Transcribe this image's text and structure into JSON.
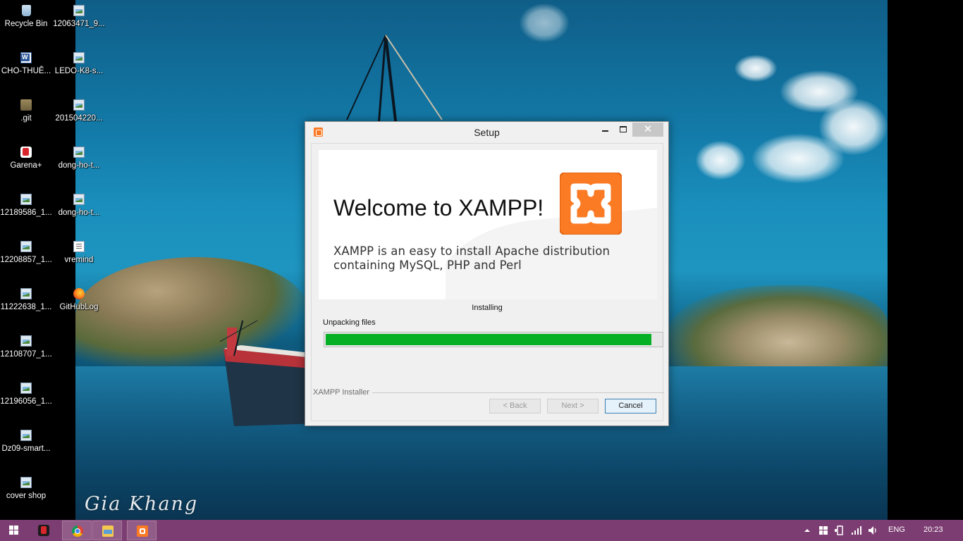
{
  "desktop": {
    "icons": [
      {
        "label": "Recycle Bin",
        "icon": "recycle-bin-icon"
      },
      {
        "label": "12063471_9...",
        "icon": "image-file-icon"
      },
      {
        "label": "CHO-THUÊ...",
        "icon": "word-document-icon"
      },
      {
        "label": "LEDO-K8-s...",
        "icon": "image-file-icon"
      },
      {
        "label": ".git",
        "icon": "folder-icon"
      },
      {
        "label": "201504220...",
        "icon": "image-file-icon"
      },
      {
        "label": "Garena+",
        "icon": "garena-icon"
      },
      {
        "label": "dong-ho-t...",
        "icon": "image-file-icon"
      },
      {
        "label": "12189586_1...",
        "icon": "image-file-icon"
      },
      {
        "label": "dong-ho-t...",
        "icon": "image-file-icon"
      },
      {
        "label": "12208857_1...",
        "icon": "image-file-icon"
      },
      {
        "label": "vremind",
        "icon": "text-file-icon"
      },
      {
        "label": "11222638_1...",
        "icon": "image-file-icon"
      },
      {
        "label": "GitHubLog",
        "icon": "firefox-icon"
      },
      {
        "label": "12108707_1...",
        "icon": "image-file-icon"
      },
      {
        "label": "12196056_1...",
        "icon": "image-file-icon"
      },
      {
        "label": "Dz09-smart...",
        "icon": "image-file-icon"
      },
      {
        "label": "cover shop",
        "icon": "image-file-icon"
      }
    ],
    "signature": "Gia Khang"
  },
  "setup_window": {
    "title": "Setup",
    "minimize_label": "",
    "maximize_label": "",
    "close_label": "✕",
    "banner": {
      "heading": "Welcome to XAMPP!",
      "description_line1": "XAMPP is an easy to install Apache distribution",
      "description_line2": "containing MySQL, PHP and Perl"
    },
    "status": "Installing",
    "detail": "Unpacking files",
    "progress": 0.97,
    "footer_label": "XAMPP Installer",
    "buttons": {
      "back": "< Back",
      "next": "Next >",
      "cancel": "Cancel"
    },
    "colors": {
      "progress": "#06b025",
      "xampp_orange": "#fb7a24"
    }
  },
  "taskbar": {
    "apps": [
      "garena-icon",
      "chrome-icon",
      "file-explorer-icon",
      "xampp-icon"
    ],
    "tray": {
      "language": "ENG",
      "time": "20:23"
    },
    "color": "#7c3d72"
  }
}
